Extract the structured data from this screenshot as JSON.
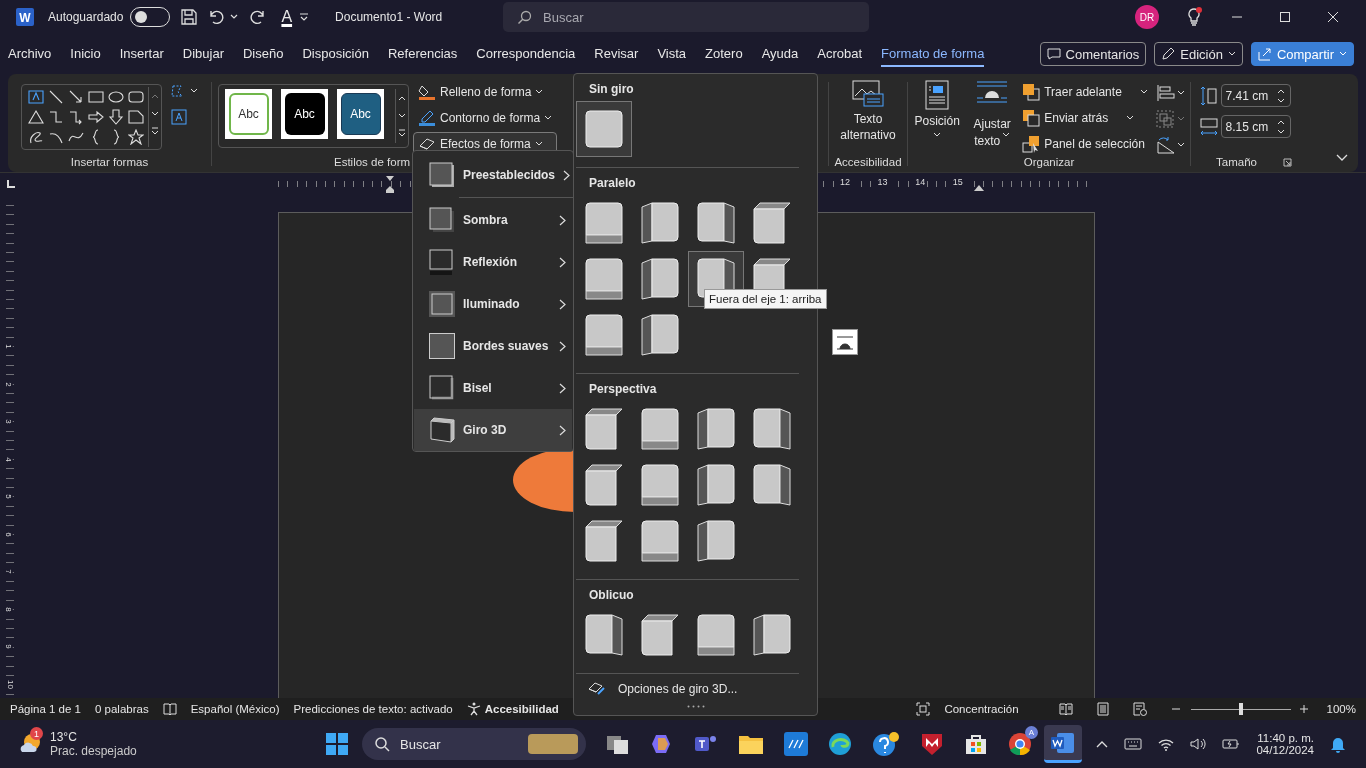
{
  "title_bar": {
    "logo_letter": "W",
    "autosave": {
      "label": "Autoguardado",
      "on": false
    },
    "font_color_glyph": "A",
    "document_title": "Documento1  -  Word",
    "search": {
      "placeholder": "Buscar"
    },
    "avatar": "DR"
  },
  "ribbon_tabs": [
    {
      "label": "Archivo",
      "selected": false
    },
    {
      "label": "Inicio",
      "selected": false
    },
    {
      "label": "Insertar",
      "selected": false
    },
    {
      "label": "Dibujar",
      "selected": false
    },
    {
      "label": "Diseño",
      "selected": false
    },
    {
      "label": "Disposición",
      "selected": false
    },
    {
      "label": "Referencias",
      "selected": false
    },
    {
      "label": "Correspondencia",
      "selected": false
    },
    {
      "label": "Revisar",
      "selected": false
    },
    {
      "label": "Vista",
      "selected": false
    },
    {
      "label": "Zotero",
      "selected": false
    },
    {
      "label": "Ayuda",
      "selected": false
    },
    {
      "label": "Acrobat",
      "selected": false
    },
    {
      "label": "Formato de forma",
      "selected": true
    }
  ],
  "ribbon_actions": {
    "comments": "Comentarios",
    "editing": "Edición",
    "share": "Compartir"
  },
  "ribbon": {
    "insert_shapes": {
      "label": "Insertar formas"
    },
    "shape_styles": {
      "label": "Estilos de form",
      "swatches": [
        {
          "text": "Abc",
          "kind": "outline"
        },
        {
          "text": "Abc",
          "kind": "dark"
        },
        {
          "text": "Abc",
          "kind": "blue"
        }
      ],
      "buttons": [
        {
          "label": "Relleno de forma",
          "pressed": false
        },
        {
          "label": "Contorno de forma",
          "pressed": false
        },
        {
          "label": "Efectos de forma",
          "pressed": true
        }
      ]
    },
    "accessibility": {
      "label": "Accesibilidad",
      "alt_text": "Texto alternativo"
    },
    "arrange": {
      "label": "Organizar",
      "position": "Posición",
      "wrap_text_1": "Ajustar",
      "wrap_text_2": "texto",
      "bring_forward": "Traer adelante",
      "send_backward": "Enviar atrás",
      "selection_pane": "Panel de selección"
    },
    "size": {
      "label": "Tamaño",
      "height": "7.41 cm",
      "width": "8.15 cm"
    }
  },
  "ruler": {
    "h_numbers": [
      "12",
      "13",
      "14",
      "15"
    ],
    "v_numbers": [
      "1",
      "2",
      "3",
      "4",
      "5",
      "6",
      "7",
      "8",
      "9",
      "10"
    ]
  },
  "effects_menu": {
    "items": [
      {
        "label": "Preestablecidos",
        "kind": "preset",
        "selected": false
      },
      {
        "label": "Sombra",
        "kind": "shadow",
        "selected": false
      },
      {
        "label": "Reflexión",
        "kind": "reflection",
        "selected": false
      },
      {
        "label": "Iluminado",
        "kind": "glow",
        "selected": false
      },
      {
        "label": "Bordes suaves",
        "kind": "soft-edges",
        "selected": false
      },
      {
        "label": "Bisel",
        "kind": "bevel",
        "selected": false
      },
      {
        "label": "Giro 3D",
        "kind": "rotation",
        "selected": true
      }
    ]
  },
  "rotation_gallery": {
    "sections": [
      {
        "title": "Sin giro",
        "items": [
          {
            "selected": true
          }
        ]
      },
      {
        "title": "Paralelo",
        "items": [
          {
            "selected": false
          },
          {
            "selected": false
          },
          {
            "selected": false
          },
          {
            "selected": false
          },
          {
            "selected": false
          },
          {
            "selected": false
          },
          {
            "selected": true
          },
          {
            "selected": false
          },
          {
            "selected": false
          },
          {
            "selected": false
          }
        ]
      },
      {
        "title": "Perspectiva",
        "items": [
          {
            "selected": false
          },
          {
            "selected": false
          },
          {
            "selected": false
          },
          {
            "selected": false
          },
          {
            "selected": false
          },
          {
            "selected": false
          },
          {
            "selected": false
          },
          {
            "selected": false
          },
          {
            "selected": false
          },
          {
            "selected": false
          },
          {
            "selected": false
          }
        ]
      },
      {
        "title": "Oblicuo",
        "items": [
          {
            "selected": false
          },
          {
            "selected": false
          },
          {
            "selected": false
          },
          {
            "selected": false
          }
        ]
      }
    ],
    "options": "Opciones de giro 3D...",
    "tooltip": "Fuera del eje 1: arriba"
  },
  "status_bar": {
    "page": "Página 1 de 1",
    "words": "0 palabras",
    "language": "Español (México)",
    "predictions": "Predicciones de texto: activado",
    "accessibility": "Accesibilidad",
    "focus": "Concentración",
    "zoom_slider": {
      "level": 0.5
    },
    "zoom": "100%"
  },
  "taskbar": {
    "weather_badge": "1",
    "temperature": "13°C",
    "condition": "Prac. despejado",
    "search": "Buscar",
    "chrome_badge": "A",
    "time": "11:40 p. m.",
    "date": "04/12/2024"
  }
}
